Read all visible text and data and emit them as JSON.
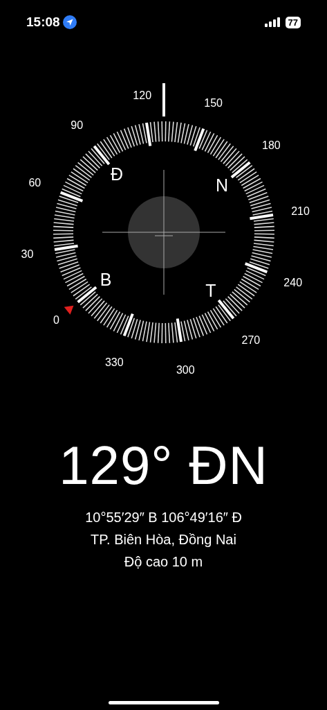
{
  "status_bar": {
    "time": "15:08",
    "battery": "77"
  },
  "compass": {
    "dial_labels": [
      "0",
      "30",
      "60",
      "90",
      "120",
      "150",
      "180",
      "210",
      "240",
      "270",
      "300",
      "330"
    ],
    "cardinals": [
      "B",
      "Đ",
      "N",
      "T"
    ]
  },
  "heading": "129° ĐN",
  "coordinates": "10°55′29″ B  106°49′16″ Đ",
  "place": "TP. Biên Hòa, Đồng Nai",
  "elevation": "Độ cao 10 m"
}
